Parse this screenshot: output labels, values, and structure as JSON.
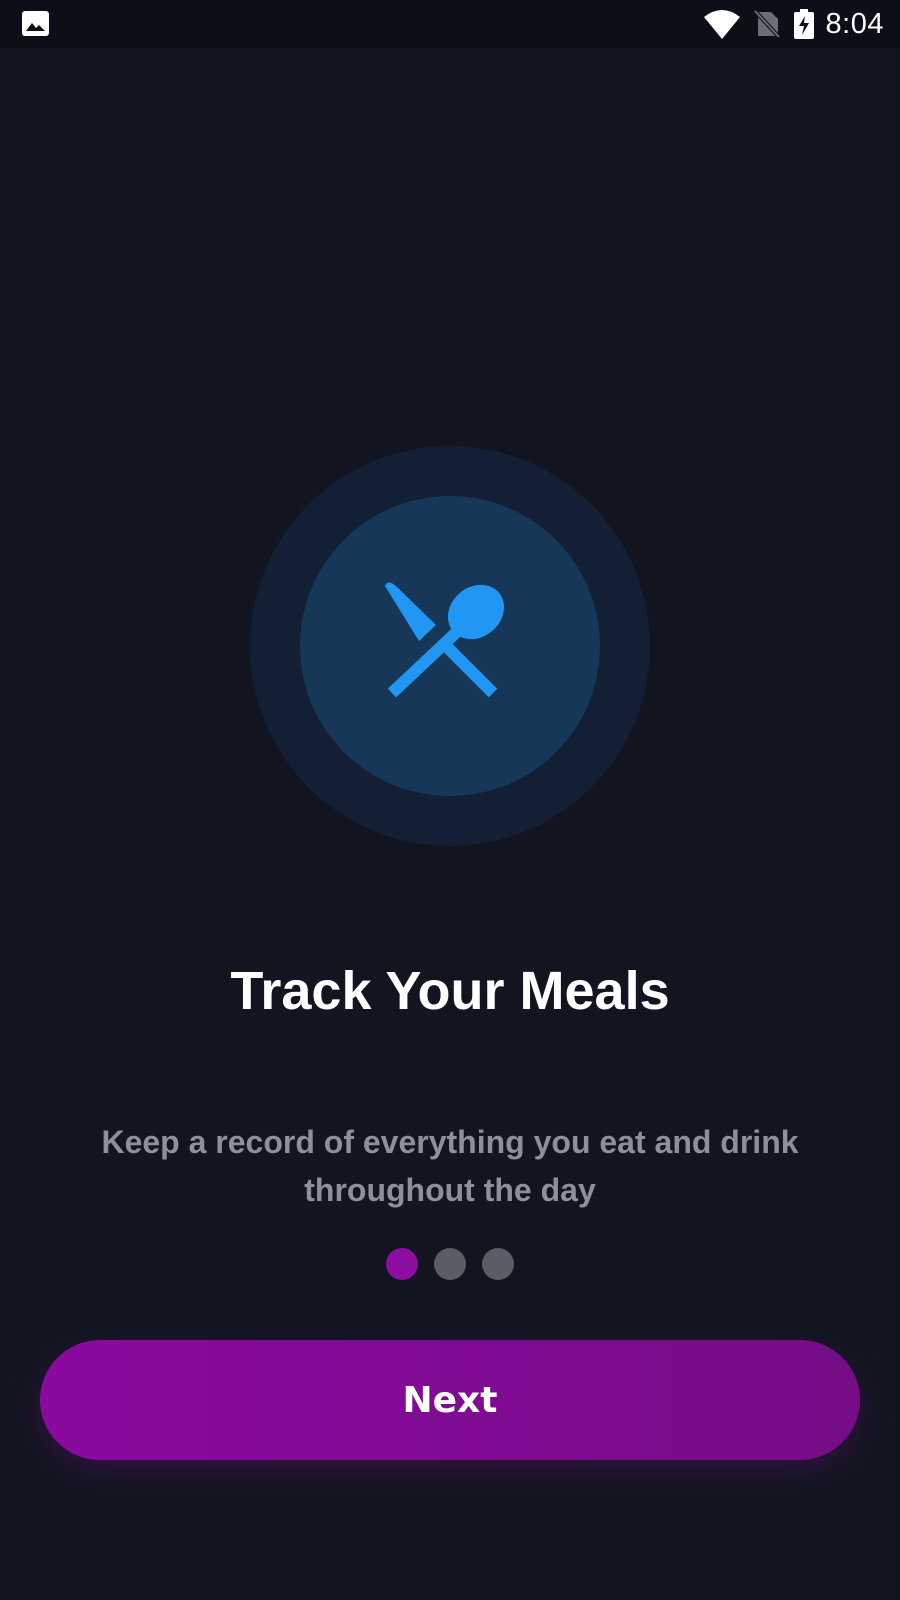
{
  "status_bar": {
    "time": "8:04",
    "left_icon": "image-icon",
    "icons": [
      "wifi-icon",
      "no-sim-icon",
      "battery-charging-icon"
    ]
  },
  "onboarding": {
    "illustration_icon": "restaurant-icon",
    "title": "Track Your Meals",
    "subtitle": "Keep a record of everything you eat and drink throughout the day",
    "page_count": 3,
    "current_page": 1,
    "next_label": "Next"
  },
  "colors": {
    "background": "#121520",
    "accent": "#8e0ea3",
    "icon_blue": "#2196f3",
    "outer_circle": "#121f35",
    "inner_circle": "#173759",
    "inactive_dot": "#585d66",
    "subtitle_text": "#8d9099"
  }
}
